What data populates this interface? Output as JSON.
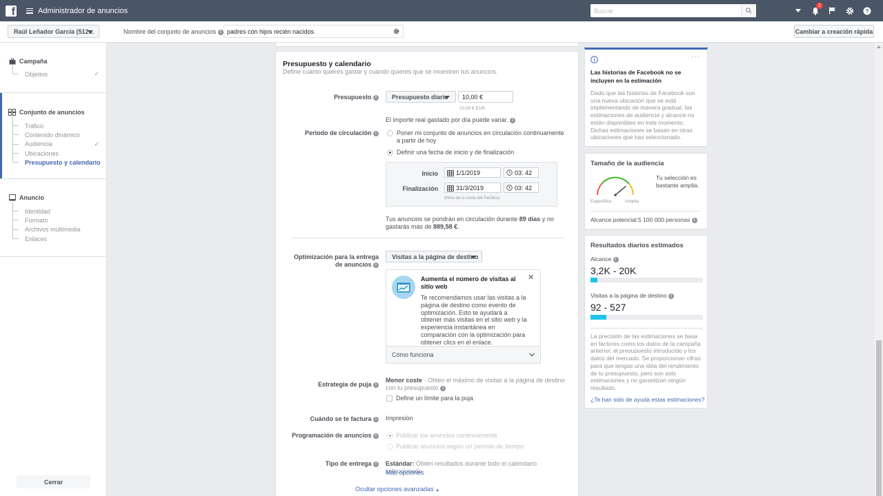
{
  "topbar": {
    "logo_letter": "f",
    "title": "Administrador de anuncios",
    "search_placeholder": "Buscar",
    "notification_count": "2"
  },
  "subbar": {
    "account": "Raúl Leñador García (512...",
    "adset_label": "Nombre del conjunto de anuncios",
    "adset_value": "padres con hijos recién nacidos",
    "quick_creation": "Cambiar a creación rápida"
  },
  "sidebar": {
    "campaign": {
      "label": "Campaña",
      "items": [
        {
          "label": "Objetivo",
          "checked": true
        }
      ]
    },
    "adset": {
      "label": "Conjunto de anuncios",
      "items": [
        {
          "label": "Tráfico",
          "checked": false
        },
        {
          "label": "Contenido dinámico",
          "checked": false
        },
        {
          "label": "Audiencia",
          "checked": true
        },
        {
          "label": "Ubicaciones",
          "checked": false
        },
        {
          "label": "Presupuesto y calendario",
          "checked": false,
          "active": true
        }
      ]
    },
    "ad": {
      "label": "Anuncio",
      "items": [
        {
          "label": "Identidad"
        },
        {
          "label": "Formato"
        },
        {
          "label": "Archivos multimedia"
        },
        {
          "label": "Enlaces"
        }
      ]
    },
    "close": "Cerrar"
  },
  "main": {
    "title": "Presupuesto y calendario",
    "subtitle": "Define cuánto quieres gastar y cuándo quieres que se muestren tus anuncios.",
    "budget": {
      "label": "Presupuesto",
      "type": "Presupuesto diario",
      "value": "10,00 €",
      "below": "10,00 € EUR",
      "note": "El importe real gastado por día puede variar."
    },
    "schedule": {
      "label": "Periodo de circulación",
      "option1": "Poner mi conjunto de anuncios en circulación continuamente a partir de hoy",
      "option2": "Definir una fecha de inicio y de finalización",
      "start_label": "Inicio",
      "start_date": "1/1/2019",
      "start_time": "03: 42",
      "end_label": "Finalización",
      "end_date": "31/3/2019",
      "end_time": "03: 42",
      "timezone": "(Hora de la costa del Pacífico)",
      "summary_a": "Tus anuncios se pondrán en circulación durante ",
      "summary_days": "89 días",
      "summary_b": " y no gastarás más de ",
      "summary_amount": "889,58 €",
      "summary_c": "."
    },
    "optimization": {
      "label": "Optimización para la entrega de anuncios",
      "value": "Visitas a la página de destino",
      "rec_title": "Aumenta el número de visitas al sitio web",
      "rec_text": "Te recomendamos usar las visitas a la página de destino como evento de optimización. Esto te ayudará a obtener más visitas en el sitio web y la experiencia instantánea en comparación con la optimización para obtener clics en el enlace.",
      "rec_footer": "Cómo funciona"
    },
    "bid": {
      "label": "Estrategia de puja",
      "strong": "Menor coste",
      "text": " · Obtén el máximo de visitas a la página de destino con tu presupuesto",
      "limit": "Define un límite para la puja"
    },
    "billing": {
      "label": "Cuándo se te factura",
      "value": "Impresión"
    },
    "ad_scheduling": {
      "label": "Programación de anuncios",
      "option1": "Publicar los anuncios continuamente",
      "option2": "Publicar anuncios según un periodo de tiempo"
    },
    "delivery": {
      "label": "Tipo de entrega",
      "strong": "Estándar:",
      "text": " Obtén resultados durante todo el calendario seleccionado",
      "more": "Más opciones"
    },
    "hide_advanced": "Ocultar opciones avanzadas"
  },
  "right": {
    "notice": {
      "title": "Las historias de Facebook no se incluyen en la estimación",
      "text": "Dado que las historias de Facebook son una nueva ubicación que se está implementando de manera gradual, las estimaciones de audiencia y alcance no están disponibles en este momento. Dichas estimaciones se basan en otras ubicaciones que has seleccionado."
    },
    "audience": {
      "title": "Tamaño de la audiencia",
      "specific": "Específica",
      "broad": "Amplia",
      "message": "Tu selección es bastante amplia.",
      "potential": "Alcance potencial:5 100 000 personas",
      "gauge_fraction": 0.78
    },
    "daily": {
      "title": "Resultados diarios estimados",
      "reach_label": "Alcance",
      "reach_value": "3,2K - 20K",
      "reach_fraction": 0.06,
      "visits_label": "Visitas a la página de destino",
      "visits_value": "92 - 527",
      "visits_fraction": 0.14,
      "note": "La precisión de las estimaciones se basa en factores como los datos de la campaña anterior, el presupuesto introducido y los datos del mercado. Se proporcionan cifras para que tengas una idea del rendimiento de tu presupuesto, pero son solo estimaciones y no garantizan ningún resultado.",
      "helpful": "¿Te han sido de ayuda estas estimaciones?"
    }
  },
  "colors": {
    "topbar": "#4a5566",
    "link": "#4267b2",
    "estimate_bar": "#1cc4ea",
    "accent_blue": "#4267b2"
  }
}
